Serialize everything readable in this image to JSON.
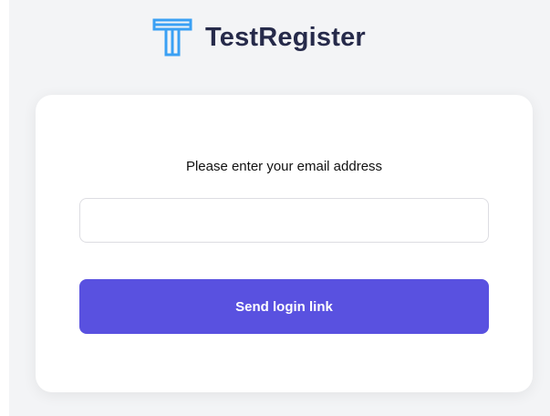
{
  "brand": {
    "name": "TestRegister",
    "logo_icon": "testregister-logo-icon",
    "logo_color": "#3aa0f4",
    "name_color": "#262a4a"
  },
  "login_form": {
    "prompt": "Please enter your email address",
    "email_value": "",
    "email_placeholder": "",
    "submit_label": "Send login link",
    "submit_color": "#5951e0"
  },
  "colors": {
    "page_background": "#f3f4f6",
    "card_background": "#ffffff"
  }
}
